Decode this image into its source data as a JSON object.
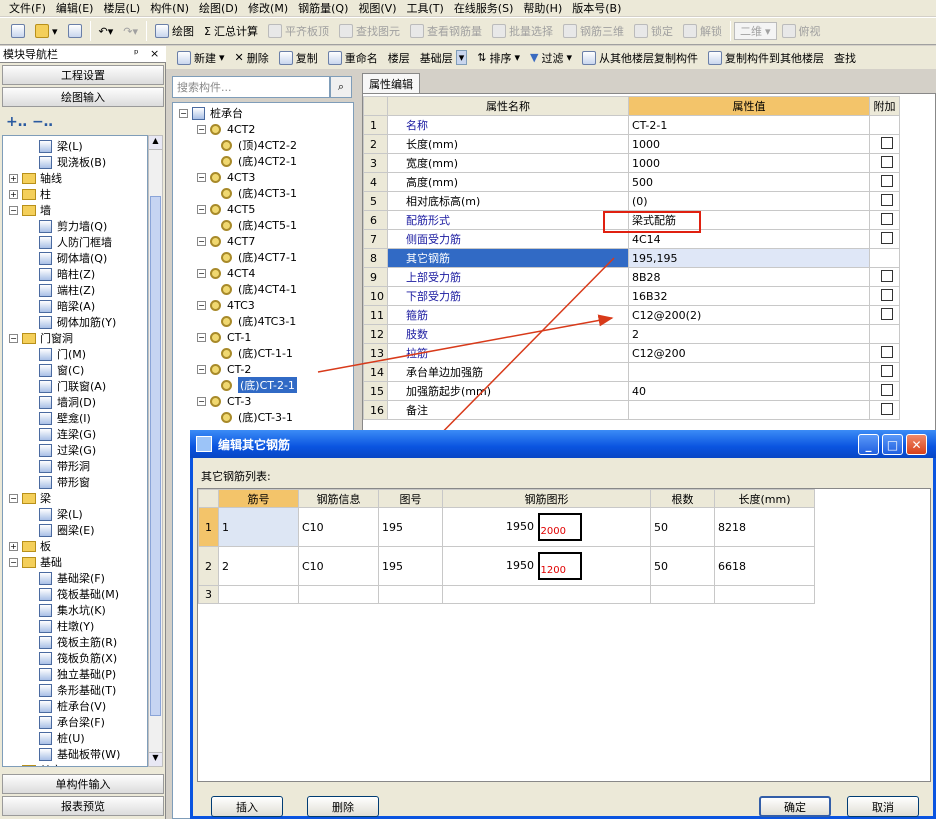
{
  "menu": [
    "文件(F)",
    "编辑(E)",
    "楼层(L)",
    "构件(N)",
    "绘图(D)",
    "修改(M)",
    "钢筋量(Q)",
    "视图(V)",
    "工具(T)",
    "在线服务(S)",
    "帮助(H)",
    "版本号(B)"
  ],
  "toolbar1": {
    "draw": "绘图",
    "sum": "汇总计算",
    "flat_roof": "平齐板顶",
    "find_elem": "查找图元",
    "view_rebar": "查看钢筋量",
    "batch_select": "批量选择",
    "rebar_3d": "钢筋三维",
    "lock": "锁定",
    "unlock": "解锁",
    "view_2d": "二维",
    "view_mode": "俯视"
  },
  "left_panel": {
    "title": "模块导航栏",
    "pin": "ᵖ",
    "close": "×",
    "nav1": "工程设置",
    "nav2": "绘图输入",
    "nav3": "单构件输入",
    "nav4": "报表预览",
    "tree": [
      {
        "label": "梁(L)",
        "indent": 2,
        "type": "item"
      },
      {
        "label": "现浇板(B)",
        "indent": 2,
        "type": "item"
      },
      {
        "label": "轴线",
        "indent": 0,
        "type": "folder",
        "sign": "+"
      },
      {
        "label": "柱",
        "indent": 0,
        "type": "folder",
        "sign": "+"
      },
      {
        "label": "墙",
        "indent": 0,
        "type": "folder",
        "sign": "−"
      },
      {
        "label": "剪力墙(Q)",
        "indent": 2,
        "type": "item"
      },
      {
        "label": "人防门框墙",
        "indent": 2,
        "type": "item"
      },
      {
        "label": "砌体墙(Q)",
        "indent": 2,
        "type": "item"
      },
      {
        "label": "暗柱(Z)",
        "indent": 2,
        "type": "item"
      },
      {
        "label": "端柱(Z)",
        "indent": 2,
        "type": "item"
      },
      {
        "label": "暗梁(A)",
        "indent": 2,
        "type": "item"
      },
      {
        "label": "砌体加筋(Y)",
        "indent": 2,
        "type": "item"
      },
      {
        "label": "门窗洞",
        "indent": 0,
        "type": "folder",
        "sign": "−"
      },
      {
        "label": "门(M)",
        "indent": 2,
        "type": "item"
      },
      {
        "label": "窗(C)",
        "indent": 2,
        "type": "item"
      },
      {
        "label": "门联窗(A)",
        "indent": 2,
        "type": "item"
      },
      {
        "label": "墙洞(D)",
        "indent": 2,
        "type": "item"
      },
      {
        "label": "壁龛(I)",
        "indent": 2,
        "type": "item"
      },
      {
        "label": "连梁(G)",
        "indent": 2,
        "type": "item"
      },
      {
        "label": "过梁(G)",
        "indent": 2,
        "type": "item"
      },
      {
        "label": "带形洞",
        "indent": 2,
        "type": "item"
      },
      {
        "label": "带形窗",
        "indent": 2,
        "type": "item"
      },
      {
        "label": "梁",
        "indent": 0,
        "type": "folder",
        "sign": "−"
      },
      {
        "label": "梁(L)",
        "indent": 2,
        "type": "item"
      },
      {
        "label": "圈梁(E)",
        "indent": 2,
        "type": "item"
      },
      {
        "label": "板",
        "indent": 0,
        "type": "folder",
        "sign": "+"
      },
      {
        "label": "基础",
        "indent": 0,
        "type": "folder",
        "sign": "−"
      },
      {
        "label": "基础梁(F)",
        "indent": 2,
        "type": "item"
      },
      {
        "label": "筏板基础(M)",
        "indent": 2,
        "type": "item"
      },
      {
        "label": "集水坑(K)",
        "indent": 2,
        "type": "item"
      },
      {
        "label": "柱墩(Y)",
        "indent": 2,
        "type": "item"
      },
      {
        "label": "筏板主筋(R)",
        "indent": 2,
        "type": "item"
      },
      {
        "label": "筏板负筋(X)",
        "indent": 2,
        "type": "item"
      },
      {
        "label": "独立基础(P)",
        "indent": 2,
        "type": "item"
      },
      {
        "label": "条形基础(T)",
        "indent": 2,
        "type": "item"
      },
      {
        "label": "桩承台(V)",
        "indent": 2,
        "type": "item"
      },
      {
        "label": "承台梁(F)",
        "indent": 2,
        "type": "item"
      },
      {
        "label": "桩(U)",
        "indent": 2,
        "type": "item"
      },
      {
        "label": "基础板带(W)",
        "indent": 2,
        "type": "item"
      },
      {
        "label": "其它",
        "indent": 0,
        "type": "folder",
        "sign": "+"
      }
    ]
  },
  "toolbar2": {
    "new": "新建",
    "delete": "删除",
    "copy": "复制",
    "rename": "重命名",
    "floor_label": "楼层",
    "floor_value": "基础层",
    "sort": "排序",
    "filter": "过滤",
    "copy_from": "从其他楼层复制构件",
    "copy_to": "复制构件到其他楼层",
    "find": "查找"
  },
  "search_placeholder": "搜索构件...",
  "component_tree": {
    "root": "桩承台",
    "items": [
      {
        "label": "4CT2",
        "level": 1
      },
      {
        "label": "(顶)4CT2-2",
        "level": 2
      },
      {
        "label": "(底)4CT2-1",
        "level": 2
      },
      {
        "label": "4CT3",
        "level": 1
      },
      {
        "label": "(底)4CT3-1",
        "level": 2
      },
      {
        "label": "4CT5",
        "level": 1
      },
      {
        "label": "(底)4CT5-1",
        "level": 2
      },
      {
        "label": "4CT7",
        "level": 1
      },
      {
        "label": "(底)4CT7-1",
        "level": 2
      },
      {
        "label": "4CT4",
        "level": 1
      },
      {
        "label": "(底)4CT4-1",
        "level": 2
      },
      {
        "label": "4TC3",
        "level": 1
      },
      {
        "label": "(底)4TC3-1",
        "level": 2
      },
      {
        "label": "CT-1",
        "level": 1
      },
      {
        "label": "(底)CT-1-1",
        "level": 2
      },
      {
        "label": "CT-2",
        "level": 1
      },
      {
        "label": "(底)CT-2-1",
        "level": 2,
        "selected": true
      },
      {
        "label": "CT-3",
        "level": 1
      },
      {
        "label": "(底)CT-3-1",
        "level": 2
      }
    ]
  },
  "prop_tab": "属性编辑",
  "prop_headers": {
    "name": "属性名称",
    "value": "属性值",
    "extra": "附加"
  },
  "props": [
    {
      "n": "1",
      "name": "名称",
      "value": "CT-2-1",
      "blue": true,
      "cb": false
    },
    {
      "n": "2",
      "name": "长度(mm)",
      "value": "1000",
      "blue": false,
      "cb": true
    },
    {
      "n": "3",
      "name": "宽度(mm)",
      "value": "1000",
      "blue": false,
      "cb": true
    },
    {
      "n": "4",
      "name": "高度(mm)",
      "value": "500",
      "blue": false,
      "cb": true
    },
    {
      "n": "5",
      "name": "相对底标高(m)",
      "value": "(0)",
      "blue": false,
      "cb": true
    },
    {
      "n": "6",
      "name": "配筋形式",
      "value": "梁式配筋",
      "blue": true,
      "cb": true
    },
    {
      "n": "7",
      "name": "侧面受力筋",
      "value": "4C14",
      "blue": true,
      "cb": true
    },
    {
      "n": "8",
      "name": "其它钢筋",
      "value": "195,195",
      "blue": false,
      "cb": false,
      "selected": true
    },
    {
      "n": "9",
      "name": "上部受力筋",
      "value": "8B28",
      "blue": true,
      "cb": true
    },
    {
      "n": "10",
      "name": "下部受力筋",
      "value": "16B32",
      "blue": true,
      "cb": true
    },
    {
      "n": "11",
      "name": "箍筋",
      "value": "C12@200(2)",
      "blue": true,
      "cb": true
    },
    {
      "n": "12",
      "name": "肢数",
      "value": "2",
      "blue": true,
      "cb": false
    },
    {
      "n": "13",
      "name": "拉筋",
      "value": "C12@200",
      "blue": true,
      "cb": true
    },
    {
      "n": "14",
      "name": "承台单边加强筋",
      "value": "",
      "blue": false,
      "cb": true
    },
    {
      "n": "15",
      "name": "加强筋起步(mm)",
      "value": "40",
      "blue": false,
      "cb": true
    },
    {
      "n": "16",
      "name": "备注",
      "value": "",
      "blue": false,
      "cb": true
    }
  ],
  "dialog": {
    "title": "编辑其它钢筋",
    "list_label": "其它钢筋列表:",
    "headers": [
      "筋号",
      "钢筋信息",
      "图号",
      "钢筋图形",
      "根数",
      "长度(mm)"
    ],
    "rows": [
      {
        "n": "1",
        "id": "1",
        "info": "C10",
        "fig": "195",
        "dim": "1950",
        "shape_val": "2000",
        "count": "50",
        "length": "8218"
      },
      {
        "n": "2",
        "id": "2",
        "info": "C10",
        "fig": "195",
        "dim": "1950",
        "shape_val": "1200",
        "count": "50",
        "length": "6618"
      },
      {
        "n": "3",
        "id": "",
        "info": "",
        "fig": "",
        "dim": "",
        "shape_val": "",
        "count": "",
        "length": ""
      }
    ],
    "btn_insert": "插入",
    "btn_delete": "删除",
    "btn_ok": "确定",
    "btn_cancel": "取消"
  },
  "colors": {
    "accent": "#0a54e0",
    "header_value": "#f3c46a",
    "annotation": "#d83a1a",
    "highlight": "#ff0000"
  }
}
